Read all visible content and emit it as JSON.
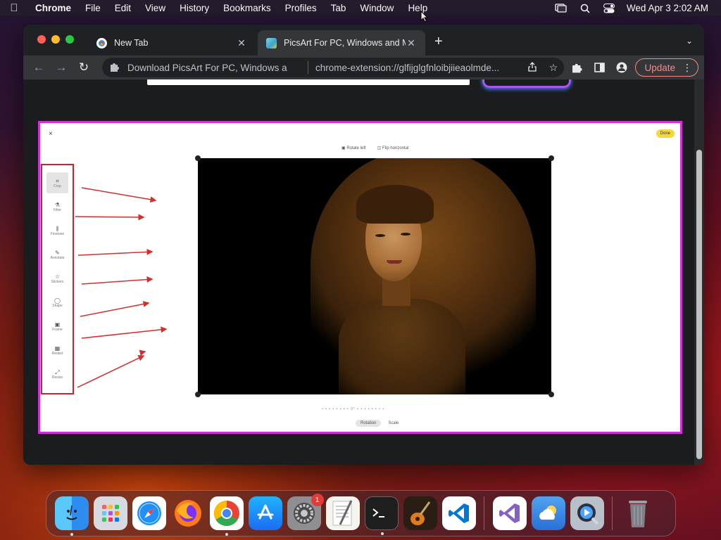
{
  "menubar": {
    "app_name": "Chrome",
    "items": [
      "File",
      "Edit",
      "View",
      "History",
      "Bookmarks",
      "Profiles",
      "Tab",
      "Window",
      "Help"
    ],
    "clock": "Wed Apr 3  2:02 AM"
  },
  "browser": {
    "tabs": [
      {
        "title": "New Tab",
        "active": false
      },
      {
        "title": "PicsArt For PC, Windows and M",
        "active": true
      }
    ],
    "omnibox": {
      "page_title": "Download PicsArt For PC, Windows a",
      "url": "chrome-extension://glfijglgfnloibjiieaolmde..."
    },
    "update_label": "Update"
  },
  "editor": {
    "close": "×",
    "done_label": "Done",
    "top_actions": [
      "Rotate left",
      "Flip horizontal"
    ],
    "tools": [
      {
        "label": "Crop",
        "icon": "crop-icon",
        "glyph": "⌗"
      },
      {
        "label": "Filter",
        "icon": "filter-icon",
        "glyph": "⚗"
      },
      {
        "label": "Finetune",
        "icon": "finetune-icon",
        "glyph": "⫼"
      },
      {
        "label": "Annotate",
        "icon": "pencil-icon",
        "glyph": "✎"
      },
      {
        "label": "Stickers",
        "icon": "star-icon",
        "glyph": "☆"
      },
      {
        "label": "Shape",
        "icon": "shape-icon",
        "glyph": "◯"
      },
      {
        "label": "Frame",
        "icon": "frame-icon",
        "glyph": "▣"
      },
      {
        "label": "Redact",
        "icon": "redact-icon",
        "glyph": "▦"
      },
      {
        "label": "Resize",
        "icon": "resize-icon",
        "glyph": "⤢"
      }
    ],
    "slider_readout": "• • • • • • • • 0° • • • • • • • •",
    "bottom_tabs": [
      "Rotation",
      "Scale"
    ]
  },
  "dock": {
    "apps": [
      {
        "name": "Finder",
        "icon": "finder-icon",
        "color": "#2d8cf0"
      },
      {
        "name": "Launchpad",
        "icon": "launchpad-icon",
        "color": "#cfd3da"
      },
      {
        "name": "Safari",
        "icon": "safari-icon",
        "color": "#1e90ff"
      },
      {
        "name": "Firefox",
        "icon": "firefox-icon",
        "color": "#ff7a1a"
      },
      {
        "name": "Chrome",
        "icon": "chrome-icon",
        "color": "#ffffff"
      },
      {
        "name": "App Store",
        "icon": "app-store-icon",
        "color": "#1c8cf2"
      },
      {
        "name": "System Settings",
        "icon": "settings-icon",
        "color": "#8e8e93",
        "badge": "1"
      },
      {
        "name": "TextEdit",
        "icon": "textedit-icon",
        "color": "#f5f5f0"
      },
      {
        "name": "Terminal",
        "icon": "terminal-icon",
        "color": "#1e1e1e"
      },
      {
        "name": "GarageBand",
        "icon": "guitar-icon",
        "color": "#3a2a20"
      },
      {
        "name": "VS Code",
        "icon": "vscode-icon",
        "color": "#ffffff"
      },
      {
        "name": "Visual Studio",
        "icon": "visual-studio-icon",
        "color": "#ffffff"
      },
      {
        "name": "Weather",
        "icon": "weather-icon",
        "color": "#3b8fe0"
      },
      {
        "name": "QuickTime",
        "icon": "quicktime-icon",
        "color": "#9aa4b0"
      },
      {
        "name": "Trash",
        "icon": "trash-icon",
        "color": "#8a8d92"
      }
    ]
  }
}
